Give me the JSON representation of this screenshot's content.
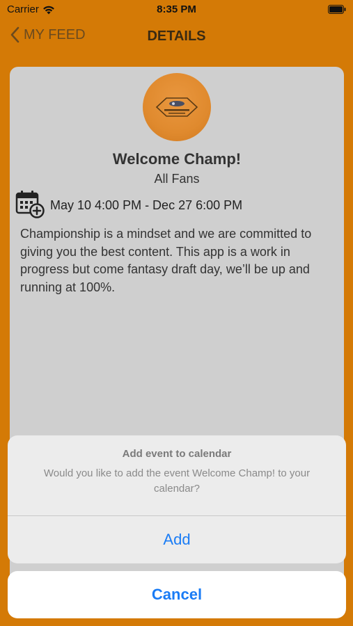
{
  "status_bar": {
    "carrier": "Carrier",
    "time": "8:35 PM"
  },
  "nav": {
    "back_label": "MY FEED",
    "title": "DETAILS"
  },
  "event": {
    "title": "Welcome Champ!",
    "audience": "All Fans",
    "date_range": "May 10 4:00 PM - Dec 27 6:00 PM",
    "description": "Championship is a mindset and we are committed to giving you the best content. This app is a work in progress but come fantasy draft day, we’ll be up and running at 100%."
  },
  "action_sheet": {
    "title": "Add event to calendar",
    "message": "Would you like to add the event Welcome Champ! to your calendar?",
    "add_label": "Add",
    "cancel_label": "Cancel"
  },
  "colors": {
    "background": "#d47a06",
    "card": "#cfcfcf",
    "action_blue": "#1a7cf5",
    "logo_orange": "#e08a2e"
  },
  "icons": [
    "wifi-icon",
    "battery-icon",
    "back-chevron-icon",
    "calendar-add-icon"
  ]
}
